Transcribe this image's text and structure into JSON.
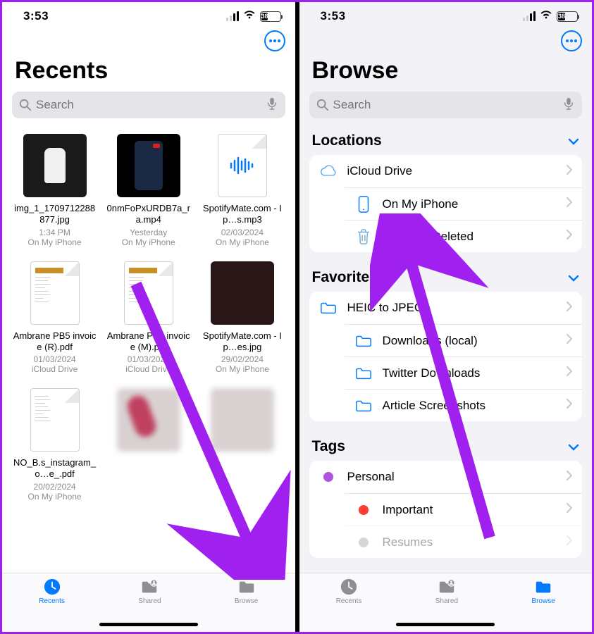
{
  "status": {
    "time": "3:53",
    "battery_pct": "38",
    "battery_fill_pct": 38
  },
  "left": {
    "title": "Recents",
    "search_placeholder": "Search",
    "files": [
      {
        "name": "img_1_1709712288877.jpg",
        "line1": "1:34 PM",
        "line2": "On My iPhone"
      },
      {
        "name": "0nmFoPxURDB7a_ra.mp4",
        "line1": "Yesterday",
        "line2": "On My iPhone"
      },
      {
        "name": "SpotifyMate.com - I p…s.mp3",
        "line1": "02/03/2024",
        "line2": "On My iPhone"
      },
      {
        "name": "Ambrane PB5 invoice (R).pdf",
        "line1": "01/03/2024",
        "line2": "iCloud Drive"
      },
      {
        "name": "Ambrane PB5 invoice (M).pdf",
        "line1": "01/03/2024",
        "line2": "iCloud Drive"
      },
      {
        "name": "SpotifyMate.com - I p…es.jpg",
        "line1": "29/02/2024",
        "line2": "On My iPhone"
      },
      {
        "name": "NO_B.s_instagram_o…e_.pdf",
        "line1": "20/02/2024",
        "line2": "On My iPhone"
      }
    ],
    "tabs": {
      "recents": "Recents",
      "shared": "Shared",
      "browse": "Browse"
    }
  },
  "right": {
    "title": "Browse",
    "search_placeholder": "Search",
    "sections": {
      "locations": {
        "header": "Locations",
        "items": [
          {
            "label": "iCloud Drive"
          },
          {
            "label": "On My iPhone"
          },
          {
            "label": "Recently Deleted"
          }
        ]
      },
      "favorites": {
        "header": "Favorites",
        "items": [
          {
            "label": "HEIC to JPEG"
          },
          {
            "label": "Downloads (local)"
          },
          {
            "label": "Twitter Downloads"
          },
          {
            "label": "Article Screenshots"
          }
        ]
      },
      "tags": {
        "header": "Tags",
        "items": [
          {
            "label": "Personal",
            "color": "#af52de"
          },
          {
            "label": "Important",
            "color": "#ff3b30"
          },
          {
            "label": "Resumes",
            "color": "#8e8e93"
          }
        ]
      }
    },
    "tabs": {
      "recents": "Recents",
      "shared": "Shared",
      "browse": "Browse"
    }
  }
}
